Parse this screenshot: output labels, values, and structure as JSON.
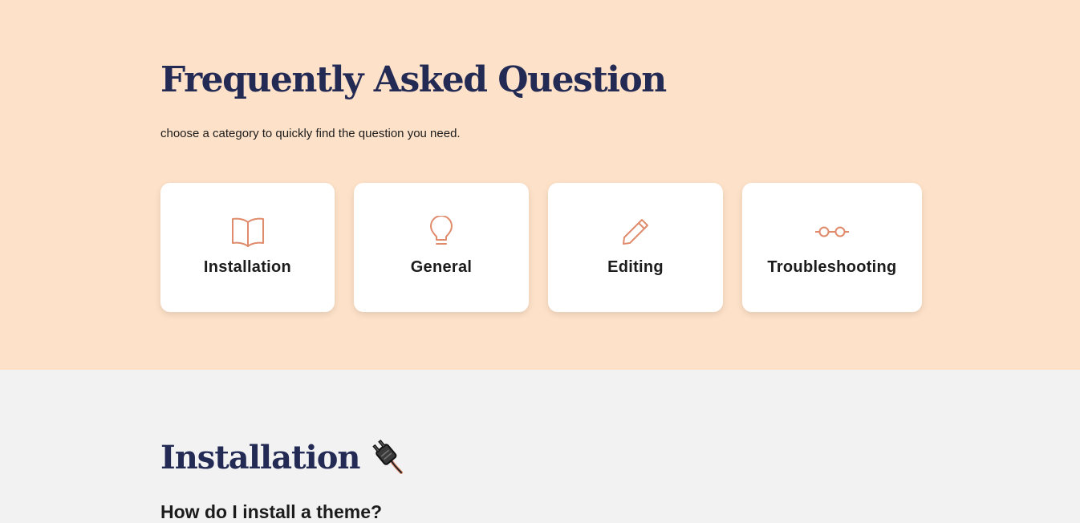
{
  "hero": {
    "title": "Frequently Asked Question",
    "subtitle": "choose a category to quickly find the question you need.",
    "accent_color": "#e08b6c",
    "title_color": "#232b55",
    "background": "#fde1c8"
  },
  "categories": [
    {
      "label": "Installation",
      "icon": "open-book-icon"
    },
    {
      "label": "General",
      "icon": "lightbulb-icon"
    },
    {
      "label": "Editing",
      "icon": "pencil-icon"
    },
    {
      "label": "Troubleshooting",
      "icon": "glasses-icon"
    }
  ],
  "section": {
    "title": "Installation",
    "emoji_icon": "electric-plug-icon",
    "questions": [
      "How do I install a theme?"
    ]
  }
}
